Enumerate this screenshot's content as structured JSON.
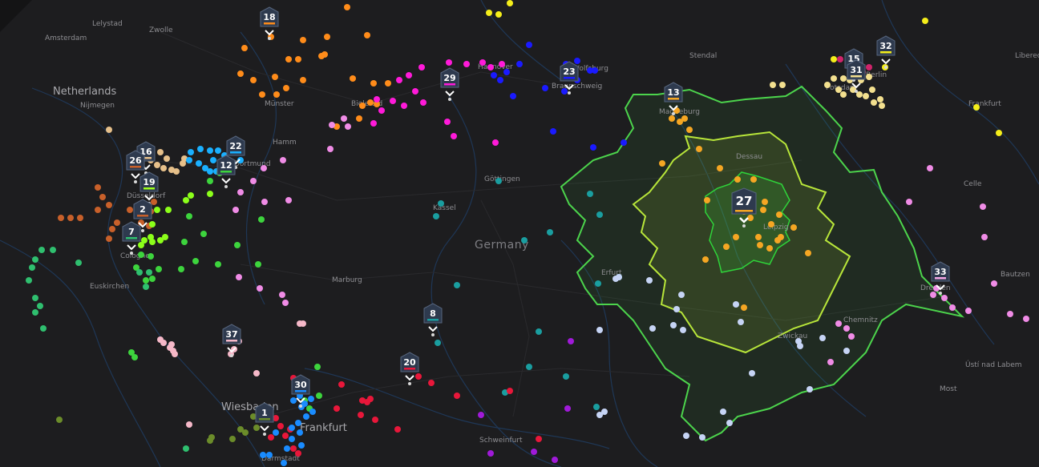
{
  "country_label": "Germany",
  "places": [
    {
      "id": "amsterdam",
      "name": "Amsterdam"
    },
    {
      "id": "zwolle",
      "name": "Zwolle"
    },
    {
      "id": "lelystad",
      "name": "Lelystad"
    },
    {
      "id": "netherlands",
      "name": "Netherlands"
    },
    {
      "id": "nijmegen",
      "name": "Nijmegen"
    },
    {
      "id": "munster",
      "name": "Münster"
    },
    {
      "id": "bielefeld",
      "name": "Bielefeld"
    },
    {
      "id": "hamm",
      "name": "Hamm"
    },
    {
      "id": "dortmund",
      "name": "Dortmund"
    },
    {
      "id": "dusseldorf",
      "name": "Düsseldorf"
    },
    {
      "id": "cologne",
      "name": "Cologne"
    },
    {
      "id": "euskirchen",
      "name": "Euskirchen"
    },
    {
      "id": "hannover",
      "name": "Hannover"
    },
    {
      "id": "wolfsburg",
      "name": "Wolfsburg"
    },
    {
      "id": "braunschweig",
      "name": "Braunschweig"
    },
    {
      "id": "stendal",
      "name": "Stendal"
    },
    {
      "id": "magdeburg",
      "name": "Magdeburg"
    },
    {
      "id": "potsdam",
      "name": "Potsdam"
    },
    {
      "id": "berlin",
      "name": "Berlin"
    },
    {
      "id": "gottingen",
      "name": "Göttingen"
    },
    {
      "id": "kassel",
      "name": "Kassel"
    },
    {
      "id": "dessau",
      "name": "Dessau"
    },
    {
      "id": "leipzig",
      "name": "Leipzig"
    },
    {
      "id": "marburg",
      "name": "Marburg"
    },
    {
      "id": "erfurt",
      "name": "Erfurt"
    },
    {
      "id": "zwickau",
      "name": "Zwickau"
    },
    {
      "id": "chemnitz",
      "name": "Chemnitz"
    },
    {
      "id": "dresden",
      "name": "Dresden"
    },
    {
      "id": "bautzen",
      "name": "Bautzen"
    },
    {
      "id": "celle",
      "name": "Celle"
    },
    {
      "id": "frankfurt_oder",
      "name": "Frankfurt"
    },
    {
      "id": "wiesbaden",
      "name": "Wiesbaden"
    },
    {
      "id": "frankfurt",
      "name": "Frankfurt"
    },
    {
      "id": "darmstadt",
      "name": "Darmstadt"
    },
    {
      "id": "schweinfurt",
      "name": "Schweinfurt"
    },
    {
      "id": "usti",
      "name": "Ústí nad Labem"
    },
    {
      "id": "most",
      "name": "Most"
    },
    {
      "id": "liberec",
      "name": "Liberec"
    }
  ],
  "clusters": [
    {
      "id": "18",
      "label": "18",
      "color": "#ff8c1a"
    },
    {
      "id": "29",
      "label": "29",
      "color": "#ff1ad9"
    },
    {
      "id": "23",
      "label": "23",
      "color": "#1a1aff"
    },
    {
      "id": "13",
      "label": "13",
      "color": "#f5a623"
    },
    {
      "id": "15",
      "label": "15",
      "color": "#d0246b"
    },
    {
      "id": "31",
      "label": "31",
      "color": "#f3e08f"
    },
    {
      "id": "32",
      "label": "32",
      "color": "#f5ee1a"
    },
    {
      "id": "16",
      "label": "16",
      "color": "#e6c08a"
    },
    {
      "id": "26",
      "label": "26",
      "color": "#c8602a"
    },
    {
      "id": "19",
      "label": "19",
      "color": "#9cff1a"
    },
    {
      "id": "22",
      "label": "22",
      "color": "#1ab0ff"
    },
    {
      "id": "12",
      "label": "12",
      "color": "#3dd43d"
    },
    {
      "id": "2",
      "label": "2",
      "color": "#c8602a"
    },
    {
      "id": "7",
      "label": "7",
      "color": "#2fbf6f"
    },
    {
      "id": "27",
      "label": "27",
      "color": "#f5a623"
    },
    {
      "id": "33",
      "label": "33",
      "color": "#f5a6e6"
    },
    {
      "id": "8",
      "label": "8",
      "color": "#1a9ea0"
    },
    {
      "id": "37",
      "label": "37",
      "color": "#f5b8c8"
    },
    {
      "id": "20",
      "label": "20",
      "color": "#e8173a"
    },
    {
      "id": "30",
      "label": "30",
      "color": "#1a8cff"
    },
    {
      "id": "1",
      "label": "1",
      "color": "#6b8c2a"
    }
  ],
  "isochrone_colors": {
    "outer": "#4cd44c",
    "middle": "#b8e63a",
    "inner": "#2fd43a"
  },
  "dot_groups": {
    "orange": "#ff8c1a",
    "magenta": "#ff1ad9",
    "blue": "#1a1aff",
    "amber": "#f5a623",
    "pink": "#f08ce6",
    "yellow": "#f5ee1a",
    "cream": "#f3e08f",
    "crimson": "#d0246b",
    "tan": "#e6c08a",
    "rust": "#c8602a",
    "sky": "#1ab0ff",
    "lime": "#8cff1a",
    "green": "#3dd43d",
    "teal": "#2fbf6f",
    "cyan": "#1a9ea0",
    "lavender": "#c6d4f5",
    "rose": "#f5b8c8",
    "red": "#e8173a",
    "azure": "#1a8cff",
    "olive": "#6b8c2a",
    "violet": "#a01ad9"
  }
}
